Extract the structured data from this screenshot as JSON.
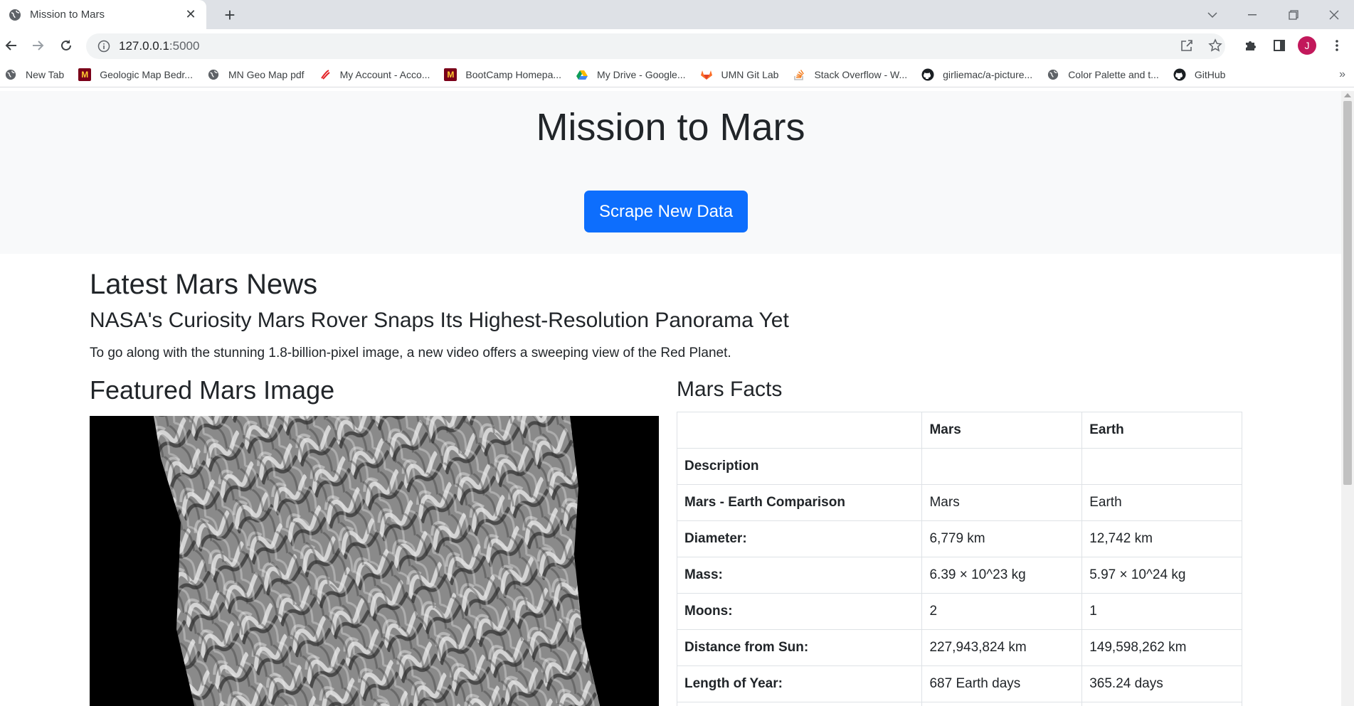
{
  "browser": {
    "tab_title": "Mission to Mars",
    "url_host": "127.0.0.1",
    "url_port": ":5000",
    "avatar_letter": "J",
    "bookmarks": [
      {
        "label": "New Tab",
        "icon": "globe-icon"
      },
      {
        "label": "Geologic Map Bedr...",
        "icon": "umn-logo-icon"
      },
      {
        "label": "MN Geo Map pdf",
        "icon": "globe-icon"
      },
      {
        "label": "My Account - Acco...",
        "icon": "swirl-logo-icon"
      },
      {
        "label": "BootCamp Homepa...",
        "icon": "umn-logo-icon"
      },
      {
        "label": "My Drive - Google...",
        "icon": "google-drive-icon"
      },
      {
        "label": "UMN Git Lab",
        "icon": "gitlab-icon"
      },
      {
        "label": "Stack Overflow - W...",
        "icon": "stack-overflow-icon"
      },
      {
        "label": "girliemac/a-picture...",
        "icon": "github-icon"
      },
      {
        "label": "Color Palette and t...",
        "icon": "globe-icon"
      },
      {
        "label": "GitHub",
        "icon": "github-icon"
      }
    ]
  },
  "page": {
    "title": "Mission to Mars",
    "scrape_button": "Scrape New Data",
    "news": {
      "heading": "Latest Mars News",
      "title": "NASA's Curiosity Mars Rover Snaps Its Highest-Resolution Panorama Yet",
      "paragraph": "To go along with the stunning 1.8-billion-pixel image, a new video offers a sweeping view of the Red Planet."
    },
    "featured": {
      "heading": "Featured Mars Image"
    },
    "facts": {
      "heading": "Mars Facts",
      "columns": [
        "",
        "Mars",
        "Earth"
      ],
      "rows": [
        {
          "label": "Description",
          "mars": "",
          "earth": ""
        },
        {
          "label": "Mars - Earth Comparison",
          "mars": "Mars",
          "earth": "Earth"
        },
        {
          "label": "Diameter:",
          "mars": "6,779 km",
          "earth": "12,742 km"
        },
        {
          "label": "Mass:",
          "mars": "6.39 × 10^23 kg",
          "earth": "5.97 × 10^24 kg"
        },
        {
          "label": "Moons:",
          "mars": "2",
          "earth": "1"
        },
        {
          "label": "Distance from Sun:",
          "mars": "227,943,824 km",
          "earth": "149,598,262 km"
        },
        {
          "label": "Length of Year:",
          "mars": "687 Earth days",
          "earth": "365.24 days"
        },
        {
          "label": "",
          "mars": "",
          "earth": ""
        }
      ]
    }
  },
  "colors": {
    "primary_button": "#0d6efd",
    "jumbotron_bg": "#f8f9fa",
    "tabstrip_bg": "#dee1e6",
    "avatar_bg": "#c2185b"
  }
}
